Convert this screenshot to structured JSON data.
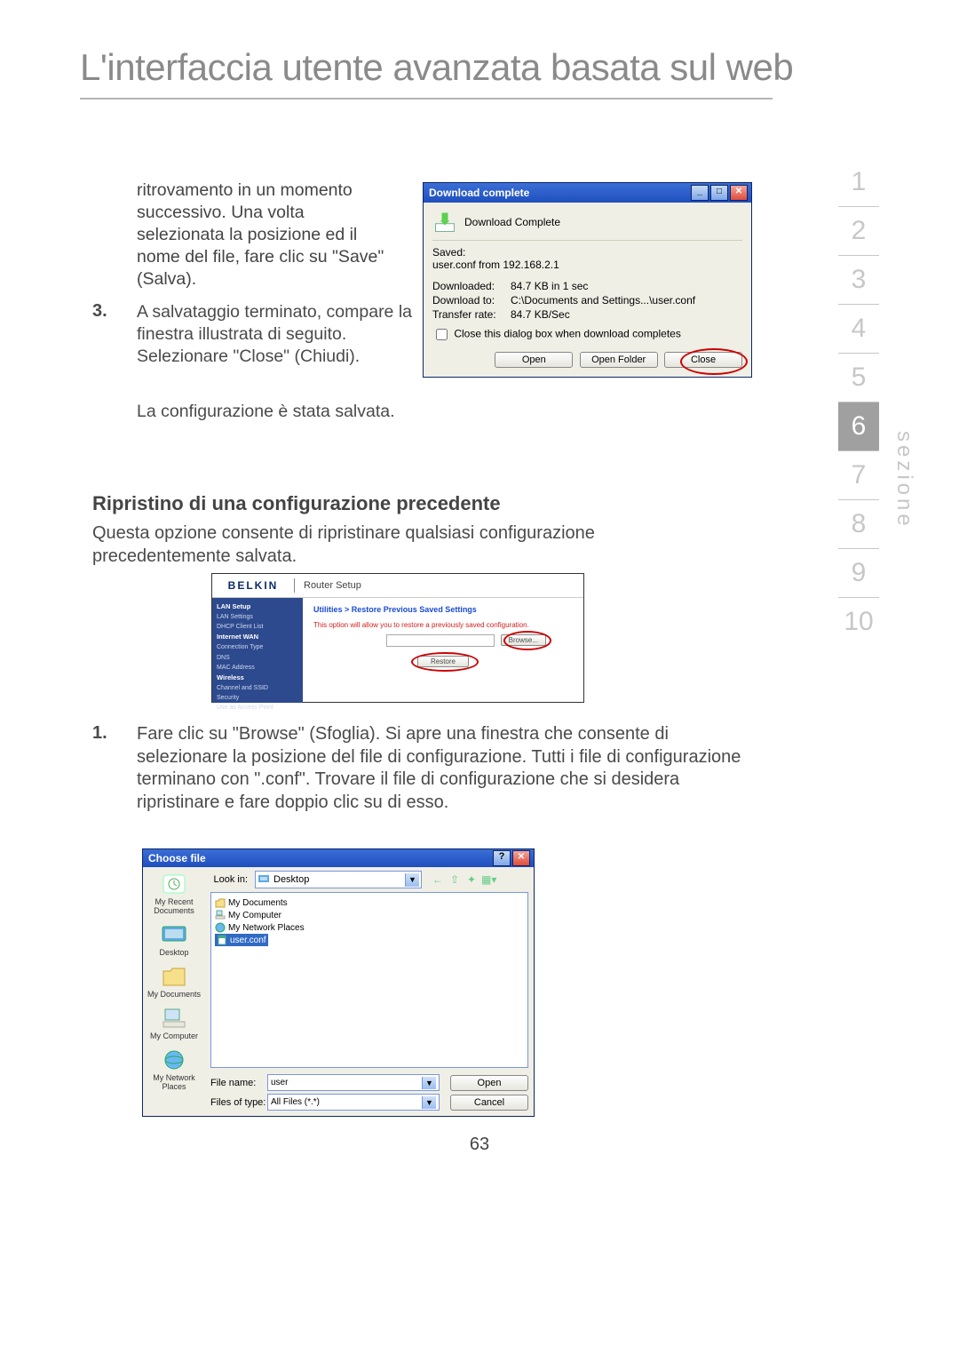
{
  "page": {
    "title": "L'interfaccia utente avanzata basata sul web",
    "number": "63",
    "sezione_label": "sezione"
  },
  "nav": {
    "items": [
      "1",
      "2",
      "3",
      "4",
      "5",
      "6",
      "7",
      "8",
      "9",
      "10"
    ],
    "active": "6"
  },
  "intro_text": "ritrovamento in un momento successivo. Una volta selezionata la posizione ed il nome del file, fare clic su \"Save\" (Salva).",
  "step3": {
    "num": "3.",
    "text": "A salvataggio terminato, compare la finestra illustrata di seguito. Selezionare \"Close\" (Chiudi)."
  },
  "config_saved": "La configurazione è stata salvata.",
  "restore": {
    "heading": "Ripristino di una configurazione precedente",
    "body": "Questa opzione consente di ripristinare qualsiasi configurazione precedentemente salvata."
  },
  "step1": {
    "num": "1.",
    "text": "Fare clic su \"Browse\" (Sfoglia). Si apre una finestra che consente di selezionare la posizione del file di configurazione. Tutti i file di configurazione terminano con \".conf\". Trovare il file di configurazione che si desidera ripristinare e fare doppio clic su di esso."
  },
  "download_dialog": {
    "title": "Download complete",
    "heading": "Download Complete",
    "saved_label": "Saved:",
    "saved_value": "user.conf from 192.168.2.1",
    "rows": {
      "downloaded_label": "Downloaded:",
      "downloaded_value": "84.7 KB in 1 sec",
      "download_to_label": "Download to:",
      "download_to_value": "C:\\Documents and Settings...\\user.conf",
      "transfer_label": "Transfer rate:",
      "transfer_value": "84.7 KB/Sec"
    },
    "checkbox_label": "Close this dialog box when download completes",
    "buttons": {
      "open": "Open",
      "open_folder": "Open Folder",
      "close": "Close"
    }
  },
  "belkin": {
    "logo": "BELKIN",
    "router_setup": "Router Setup",
    "side": {
      "lan_setup": "LAN Setup",
      "lan_settings": "LAN Settings",
      "dhcp": "DHCP Client List",
      "internet_wan": "Internet WAN",
      "conn_type": "Connection Type",
      "dns": "DNS",
      "mac": "MAC Address",
      "wireless": "Wireless",
      "chan_ssid": "Channel and SSID",
      "security": "Security",
      "use_ap": "Use as Access Point"
    },
    "crumb": "Utilities > Restore Previous Saved Settings",
    "desc": "This option will allow you to restore a previously saved configuration.",
    "browse": "Browse...",
    "restore": "Restore"
  },
  "choose_dialog": {
    "title": "Choose file",
    "lookin_label": "Look in:",
    "lookin_value": "Desktop",
    "places": {
      "recent": "My Recent Documents",
      "desktop": "Desktop",
      "mydocs": "My Documents",
      "mycomp": "My Computer",
      "mynet": "My Network Places"
    },
    "file_list": {
      "mydocs": "My Documents",
      "mycomp": "My Computer",
      "mynet": "My Network Places",
      "userconf": "user.conf"
    },
    "filename_label": "File name:",
    "filename_value": "user",
    "filetype_label": "Files of type:",
    "filetype_value": "All Files (*.*)",
    "buttons": {
      "open": "Open",
      "cancel": "Cancel"
    }
  }
}
